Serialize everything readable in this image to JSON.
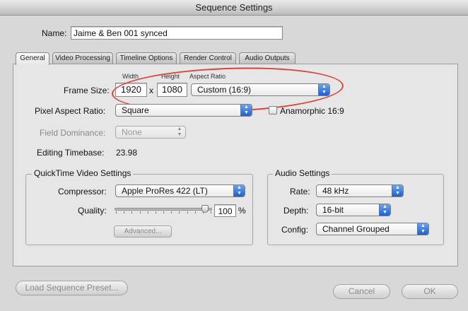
{
  "window": {
    "title": "Sequence Settings"
  },
  "name": {
    "label": "Name:",
    "value": "Jaime & Ben 001 synced"
  },
  "tabs": [
    {
      "label": "General"
    },
    {
      "label": "Video Processing"
    },
    {
      "label": "Timeline Options"
    },
    {
      "label": "Render Control"
    },
    {
      "label": "Audio Outputs"
    }
  ],
  "general": {
    "frame_size": {
      "label": "Frame Size:",
      "width_caption": "Width",
      "height_caption": "Height",
      "aspect_caption": "Aspect Ratio",
      "width": "1920",
      "separator": "x",
      "height": "1080",
      "aspect_ratio": "Custom (16:9)"
    },
    "pixel_aspect": {
      "label": "Pixel Aspect Ratio:",
      "value": "Square"
    },
    "anamorphic": {
      "label": "Anamorphic 16:9",
      "checked": false
    },
    "field_dominance": {
      "label": "Field Dominance:",
      "value": "None"
    },
    "editing_timebase": {
      "label": "Editing Timebase:",
      "value": "23.98"
    }
  },
  "quicktime": {
    "title": "QuickTime Video Settings",
    "compressor_label": "Compressor:",
    "compressor_value": "Apple ProRes 422 (LT)",
    "quality_label": "Quality:",
    "quality_value": "100",
    "quality_unit": "%",
    "quality_level": 1.0,
    "advanced_label": "Advanced..."
  },
  "audio": {
    "title": "Audio Settings",
    "rate_label": "Rate:",
    "rate_value": "48 kHz",
    "depth_label": "Depth:",
    "depth_value": "16-bit",
    "config_label": "Config:",
    "config_value": "Channel Grouped"
  },
  "footer": {
    "load_preset_label": "Load Sequence Preset...",
    "cancel_label": "Cancel",
    "ok_label": "OK"
  },
  "colors": {
    "accent_blue": "#2f6fd6",
    "highlight_red": "#d8443a"
  }
}
